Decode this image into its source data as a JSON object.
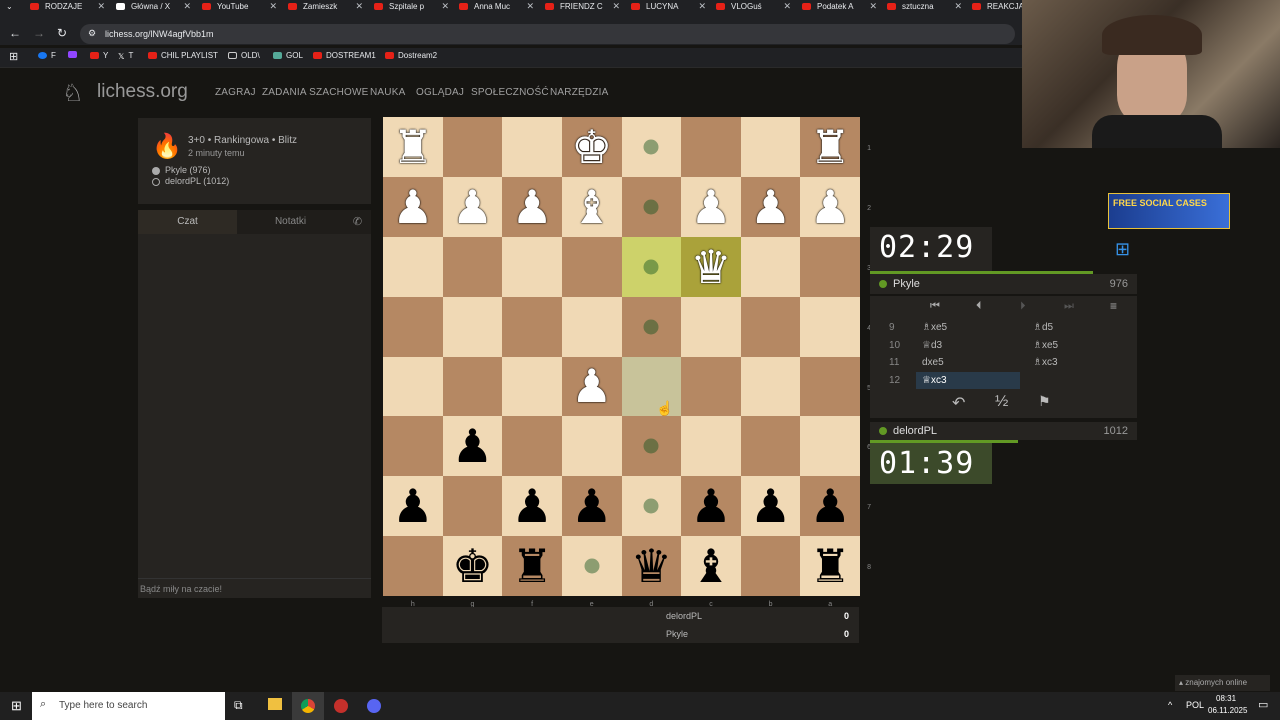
{
  "browser": {
    "tabs": [
      "RODZAJE",
      "Główna / X",
      "YouTube",
      "Zamieszk",
      "Szpitale p",
      "Anna Muc",
      "FRIENDZ C",
      "LUCYNA",
      "VLOGuś",
      "Podatek A",
      "sztuczna",
      "REAKCJA"
    ],
    "url": "lichess.org/lNW4agfVbb1m",
    "bookmarks": [
      "F",
      "Y",
      "T",
      "CHIL PLAYLIST",
      "OLD\\",
      "GOL",
      "DOSTREAM1",
      "Dostream2"
    ]
  },
  "site": {
    "logo": "lichess.org",
    "nav": [
      "ZAGRAJ",
      "ZADANIA SZACHOWE",
      "NAUKA",
      "OGLĄDAJ",
      "SPOŁECZNOŚĆ",
      "NARZĘDZIA"
    ]
  },
  "game_info": {
    "type": "3+0 • Rankingowa • Blitz",
    "time_ago": "2 minuty temu",
    "white": "Pkyle (976)",
    "black": "delordPL (1012)"
  },
  "chat": {
    "tab_chat": "Czat",
    "tab_notes": "Notatki",
    "placeholder": "Bądź miły na czacie!"
  },
  "board": {
    "ranks": [
      "1",
      "2",
      "3",
      "4",
      "5",
      "6",
      "7",
      "8"
    ],
    "files": [
      "h",
      "g",
      "f",
      "e",
      "d",
      "c",
      "b",
      "a"
    ],
    "rows": [
      [
        "wR",
        "",
        "",
        "wK",
        "",
        "",
        "",
        "wR"
      ],
      [
        "wP",
        "wP",
        "wP",
        "wB",
        "",
        "wP",
        "wP",
        "wP"
      ],
      [
        "",
        "",
        "",
        "",
        "",
        "wQ",
        "",
        ""
      ],
      [
        "",
        "",
        "",
        "",
        "",
        "",
        "",
        ""
      ],
      [
        "",
        "",
        "",
        "wP",
        "",
        "",
        "",
        ""
      ],
      [
        "",
        "bP",
        "",
        "",
        "",
        "",
        "",
        ""
      ],
      [
        "bP",
        "",
        "bP",
        "bP",
        "",
        "bP",
        "bP",
        "bP"
      ],
      [
        "",
        "bK",
        "bR",
        "",
        "bQ",
        "bB",
        "",
        "bR"
      ]
    ]
  },
  "score": {
    "p1": "delordPL",
    "s1": "0",
    "p2": "Pkyle",
    "s2": "0"
  },
  "top_player": {
    "clock": "02:29",
    "name": "Pkyle",
    "rating": "976"
  },
  "bottom_player": {
    "clock": "01:39",
    "name": "delordPL",
    "rating": "1012"
  },
  "moves": [
    {
      "n": "9",
      "w": "♗xe5",
      "b": "♗d5"
    },
    {
      "n": "10",
      "w": "♕d3",
      "b": "♗xe5"
    },
    {
      "n": "11",
      "w": "dxe5",
      "b": "♗xc3"
    },
    {
      "n": "12",
      "w": "♕xc3",
      "b": ""
    }
  ],
  "banner": "FREE SOCIAL CASES",
  "friends": "znajomych online",
  "taskbar": {
    "search": "Type here to search",
    "lang": "POL",
    "time": "08:31",
    "date": "06.11.2025"
  },
  "colors": {
    "accent": "#629924",
    "board_light": "#f0d9b5",
    "board_dark": "#b58863"
  }
}
